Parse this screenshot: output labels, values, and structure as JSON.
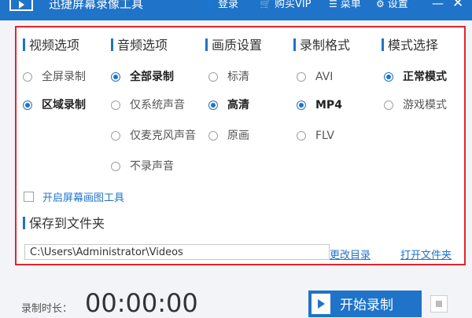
{
  "titlebar": {
    "title": "迅捷屏幕录像工具",
    "login": "登录",
    "buy_vip": "购买VIP",
    "menu": "菜单",
    "settings": "设置",
    "minimize": "—",
    "close": "✕"
  },
  "video": {
    "title": "视频选项",
    "options": [
      {
        "label": "全屏录制",
        "checked": false
      },
      {
        "label": "区域录制",
        "checked": true
      }
    ]
  },
  "audio": {
    "title": "音频选项",
    "options": [
      {
        "label": "全部录制",
        "checked": true
      },
      {
        "label": "仅系统声音",
        "checked": false
      },
      {
        "label": "仅麦克风声音",
        "checked": false
      },
      {
        "label": "不录声音",
        "checked": false
      }
    ]
  },
  "quality": {
    "title": "画质设置",
    "options": [
      {
        "label": "标清",
        "checked": false
      },
      {
        "label": "高清",
        "checked": true
      },
      {
        "label": "原画",
        "checked": false
      }
    ]
  },
  "format": {
    "title": "录制格式",
    "options": [
      {
        "label": "AVI",
        "checked": false
      },
      {
        "label": "MP4",
        "checked": true
      },
      {
        "label": "FLV",
        "checked": false
      }
    ]
  },
  "mode": {
    "title": "模式选择",
    "options": [
      {
        "label": "正常模式",
        "checked": true
      },
      {
        "label": "游戏模式",
        "checked": false
      }
    ]
  },
  "draw_tool": {
    "label": "开启屏幕画图工具",
    "checked": false
  },
  "save": {
    "title": "保存到文件夹",
    "path": "C:\\Users\\Administrator\\Videos",
    "change_dir": "更改目录",
    "open_folder": "打开文件夹"
  },
  "bottom": {
    "duration_label": "录制时长：",
    "duration": "00:00:00",
    "start_label": "开始录制"
  },
  "colors": {
    "accent": "#1f73c9",
    "highlight_border": "#e5232a"
  },
  "icons": {
    "login": "user-icon",
    "vip": "cart-icon",
    "menu": "menu-icon",
    "settings": "gear-icon"
  }
}
